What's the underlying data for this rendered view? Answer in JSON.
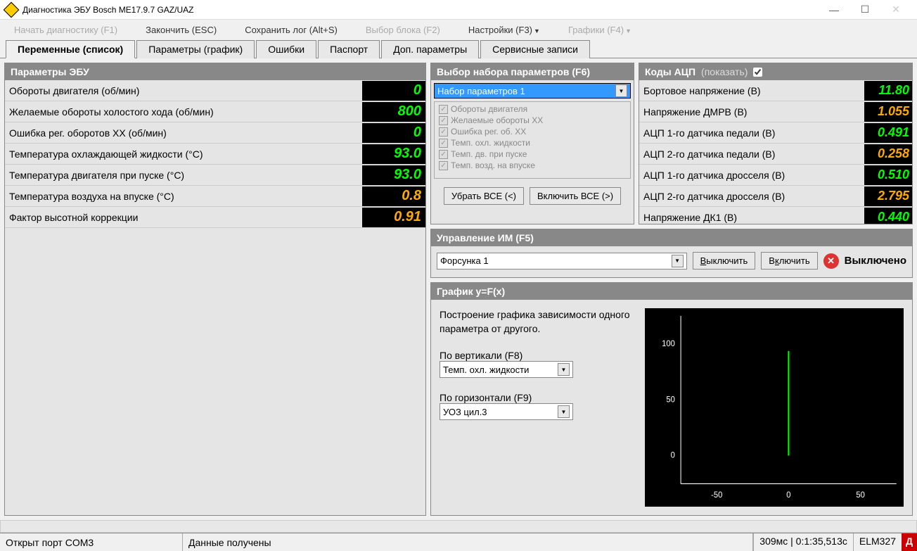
{
  "window": {
    "title": "Диагностика ЭБУ Bosch ME17.9.7 GAZ/UAZ"
  },
  "toolbar": {
    "start": "Начать диагностику (F1)",
    "finish": "Закончить (ESC)",
    "savelog": "Сохранить лог (Alt+S)",
    "block": "Выбор блока (F2)",
    "settings": "Настройки (F3)",
    "charts": "Графики (F4)"
  },
  "tabs": {
    "t0": "Переменные (список)",
    "t1": "Параметры (график)",
    "t2": "Ошибки",
    "t3": "Паспорт",
    "t4": "Доп. параметры",
    "t5": "Сервисные записи"
  },
  "ecu_params": {
    "title": "Параметры ЭБУ",
    "rows": [
      {
        "label": "Обороты двигателя (об/мин)",
        "val": "0"
      },
      {
        "label": "Желаемые обороты холостого хода (об/мин)",
        "val": "800"
      },
      {
        "label": "Ошибка рег. оборотов ХХ (об/мин)",
        "val": "0"
      },
      {
        "label": "Температура охлаждающей жидкости (°C)",
        "val": "93.0"
      },
      {
        "label": "Температура двигателя при пуске (°C)",
        "val": "93.0"
      },
      {
        "label": "Температура воздуха на впуске (°C)",
        "val": "0.8"
      },
      {
        "label": "Фактор высотной коррекции",
        "val": "0.91"
      }
    ]
  },
  "param_set": {
    "title": "Выбор набора параметров (F6)",
    "selected": "Набор параметров 1",
    "items": [
      "Обороты двигателя",
      "Желаемые обороты ХХ",
      "Ошибка рег. об. ХХ",
      "Темп. охл. жидкости",
      "Темп. дв. при пуске",
      "Темп. возд. на впуске"
    ],
    "btn_remove": "Убрать ВСЕ (<)",
    "btn_add": "Включить ВСЕ (>)"
  },
  "adc": {
    "title": "Коды АЦП",
    "show": "(показать)",
    "rows": [
      {
        "label": "Бортовое напряжение (В)",
        "val": "11.80"
      },
      {
        "label": "Напряжение ДМРВ (В)",
        "val": "1.055"
      },
      {
        "label": "АЦП 1-го датчика педали (В)",
        "val": "0.491"
      },
      {
        "label": "АЦП 2-го датчика педали (В)",
        "val": "0.258"
      },
      {
        "label": "АЦП 1-го датчика дросселя (В)",
        "val": "0.510"
      },
      {
        "label": "АЦП 2-го датчика дросселя (В)",
        "val": "2.795"
      },
      {
        "label": "Напряжение ДК1 (В)",
        "val": "0.440"
      }
    ]
  },
  "ctrl": {
    "title": "Управление ИМ (F5)",
    "selected": "Форсунка 1",
    "btn_off": "Выключить",
    "btn_on": "Включить",
    "status": "Выключено"
  },
  "graph": {
    "title": "График y=F(x)",
    "desc": "Построение графика зависимости одного параметра от другого.",
    "vlabel": "По вертикали (F8)",
    "vsel": "Темп. охл. жидкости",
    "hlabel": "По горизонтали (F9)",
    "hsel": "УОЗ цил.3"
  },
  "chart_data": {
    "type": "scatter",
    "title": "",
    "xlabel": "УОЗ цил.3",
    "ylabel": "Темп. охл. жидкости",
    "xlim": [
      -75,
      75
    ],
    "ylim": [
      -25,
      125
    ],
    "xticks": [
      -50,
      0,
      50
    ],
    "yticks": [
      0,
      50,
      100
    ],
    "series": [
      {
        "name": "data",
        "x": [
          0
        ],
        "y": [
          93
        ]
      }
    ]
  },
  "status": {
    "port": "Открыт порт COM3",
    "msg": "Данные получены",
    "timing": "309мс | 0:1:35,513с",
    "adapter": "ELM327",
    "flag": "Д"
  }
}
